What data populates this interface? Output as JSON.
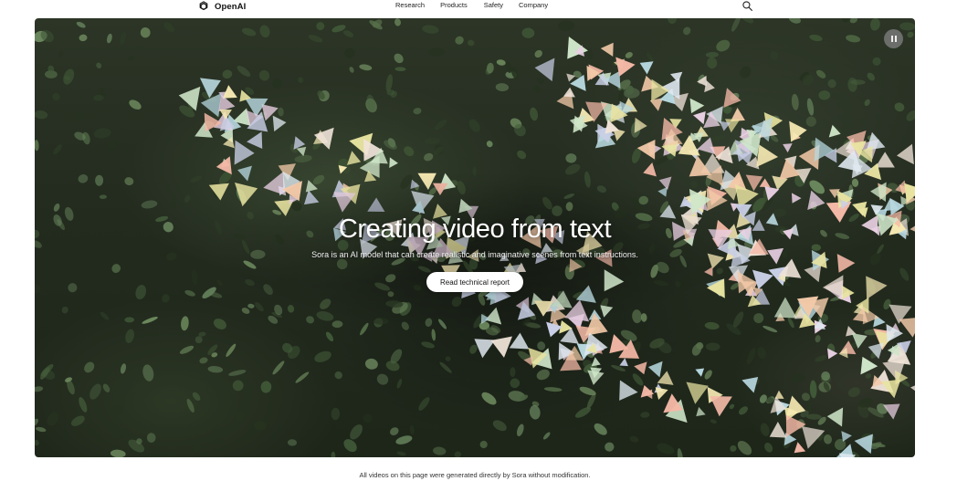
{
  "header": {
    "brand": "OpenAI",
    "logo_icon": "openai-logo-icon",
    "nav": [
      {
        "label": "Research"
      },
      {
        "label": "Products"
      },
      {
        "label": "Safety"
      },
      {
        "label": "Company"
      }
    ],
    "search_icon": "search-icon"
  },
  "hero": {
    "title": "Creating video from text",
    "subtitle": "Sora is an AI model that can create realistic and imaginative scenes from text instructions.",
    "cta_label": "Read technical report",
    "pause_icon": "pause-icon"
  },
  "caption": "All videos on this page were generated directly by Sora without modification.",
  "colors": {
    "hero_dark": "#232b1f",
    "cta_bg": "#ffffff",
    "pause_bg": "#828282"
  }
}
